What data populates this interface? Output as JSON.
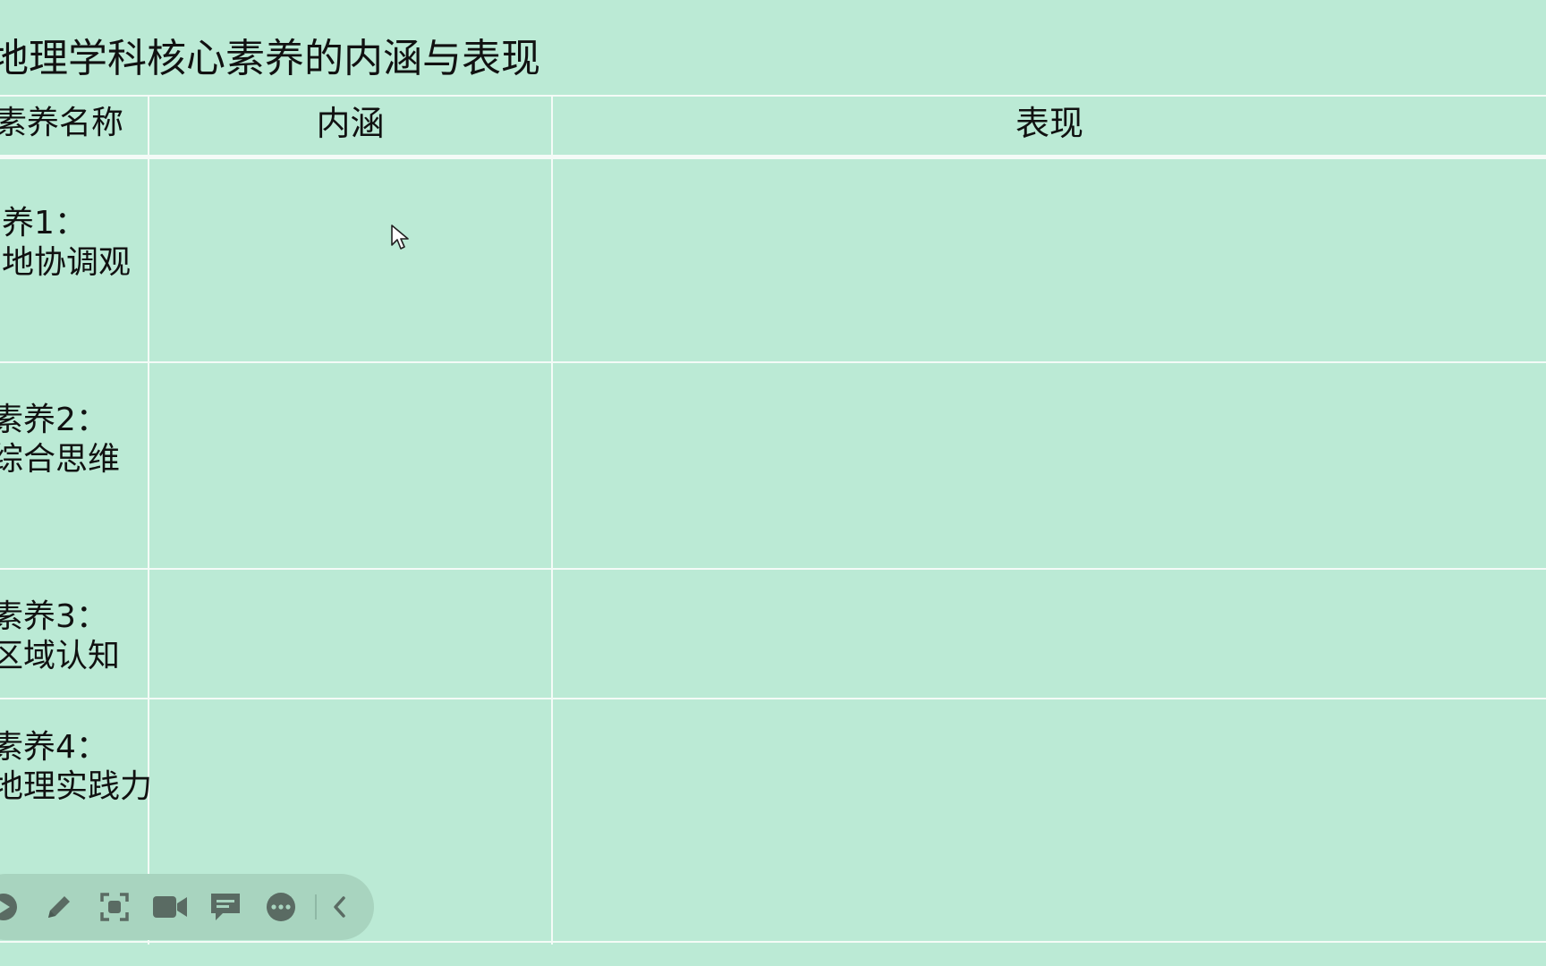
{
  "document": {
    "title": "地理学科核心素养的内涵与表现",
    "table": {
      "headers": [
        "素养名称",
        "内涵",
        "表现"
      ],
      "rows": [
        {
          "line1": "养1：",
          "line2": "地协调观"
        },
        {
          "line1": "素养2：",
          "line2": "综合思维"
        },
        {
          "line1": "素养3：",
          "line2": "区域认知"
        },
        {
          "line1": "素养4：",
          "line2": "地理实践力"
        }
      ]
    }
  },
  "toolbar": {
    "buttons": [
      {
        "icon": "play-icon"
      },
      {
        "icon": "pencil-icon"
      },
      {
        "icon": "screenshot-icon"
      },
      {
        "icon": "video-camera-icon"
      },
      {
        "icon": "comment-icon"
      },
      {
        "icon": "more-icon"
      },
      {
        "icon": "chevron-left-icon"
      }
    ]
  },
  "colors": {
    "background": "#bbead5",
    "grid": "#f4fbf7",
    "toolbar": "#a8d4bf",
    "icon": "#5a6b63"
  }
}
